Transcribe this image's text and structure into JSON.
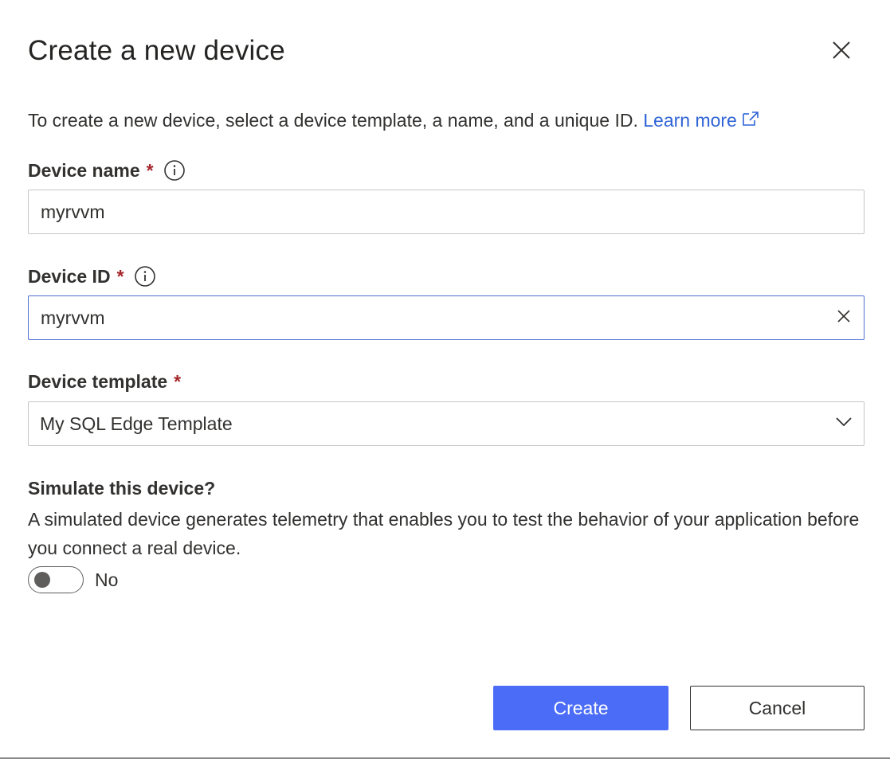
{
  "dialog": {
    "title": "Create a new device",
    "intro_text": "To create a new device, select a device template, a name, and a unique ID.",
    "learn_more": "Learn more"
  },
  "fields": {
    "device_name": {
      "label": "Device name",
      "required_mark": "*",
      "value": "myrvvm"
    },
    "device_id": {
      "label": "Device ID",
      "required_mark": "*",
      "value": "myrvvm"
    },
    "device_template": {
      "label": "Device template",
      "required_mark": "*",
      "selected": "My SQL Edge Template"
    }
  },
  "simulate": {
    "title": "Simulate this device?",
    "description": "A simulated device generates telemetry that enables you to test the behavior of your application before you connect a real device.",
    "toggle_state": "No",
    "toggle_on": false
  },
  "buttons": {
    "create": "Create",
    "cancel": "Cancel"
  },
  "colors": {
    "primary": "#4a6cf7",
    "link": "#2f64d6",
    "required": "#a4262c",
    "focus_border": "#4a6fd1"
  },
  "icons": {
    "close": "close-icon",
    "external_link": "external-link-icon",
    "info": "info-icon",
    "clear": "clear-icon",
    "chevron": "chevron-down-icon"
  }
}
